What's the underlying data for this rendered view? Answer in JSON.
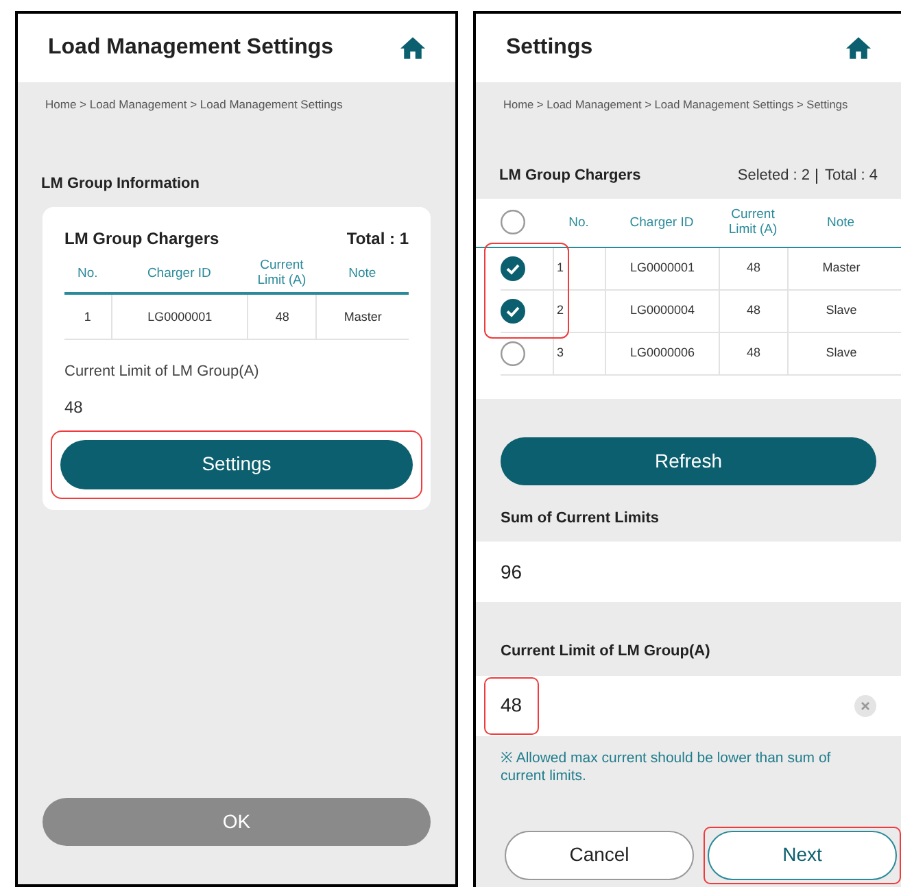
{
  "screens": [
    {
      "title": "Load Management Settings",
      "breadcrumb": "Home > Load Management > Load Management Settings",
      "section_title": "LM Group Information",
      "card": {
        "title": "LM Group Chargers",
        "total": "Total : 1",
        "columns": [
          "No.",
          "Charger ID",
          "Current Limit (A)",
          "Note"
        ],
        "rows": [
          {
            "cells": [
              "1",
              "LG0000001",
              "48",
              "Master"
            ]
          }
        ],
        "limit_label": "Current Limit of LM Group(A)",
        "limit_value": "48",
        "button": {
          "label": "Settings",
          "highlighted": true
        }
      },
      "footer_button": {
        "label": "OK",
        "disabled": true
      }
    },
    {
      "title": "Settings",
      "breadcrumb": "Home > Load Management > Load Management Settings > Settings",
      "table_title": "LM Group Chargers",
      "selected_count": "Seleted : 2",
      "total": "Total : 4",
      "select_all": {
        "checked": false
      },
      "columns": [
        "No.",
        "Charger ID",
        "Current Limit (A)",
        "Note"
      ],
      "rows": [
        {
          "checked": true,
          "cells": [
            "1",
            "LG0000001",
            "48",
            "Master"
          ]
        },
        {
          "checked": true,
          "cells": [
            "2",
            "LG0000004",
            "48",
            "Slave"
          ]
        },
        {
          "checked": false,
          "cells": [
            "3",
            "LG0000006",
            "48",
            "Slave"
          ]
        }
      ],
      "checked_rows_highlighted": true,
      "refresh_button": "Refresh",
      "sum_label": "Sum of Current Limits",
      "sum_value": "96",
      "limit_label": "Current Limit of LM Group(A)",
      "limit_value": "48",
      "limit_highlighted": true,
      "note": "※ Allowed max current should be lower than sum of current limits.",
      "buttons": [
        {
          "label": "Cancel",
          "kind": "secondary",
          "highlighted": false
        },
        {
          "label": "Next",
          "kind": "primary",
          "highlighted": true
        }
      ]
    }
  ]
}
